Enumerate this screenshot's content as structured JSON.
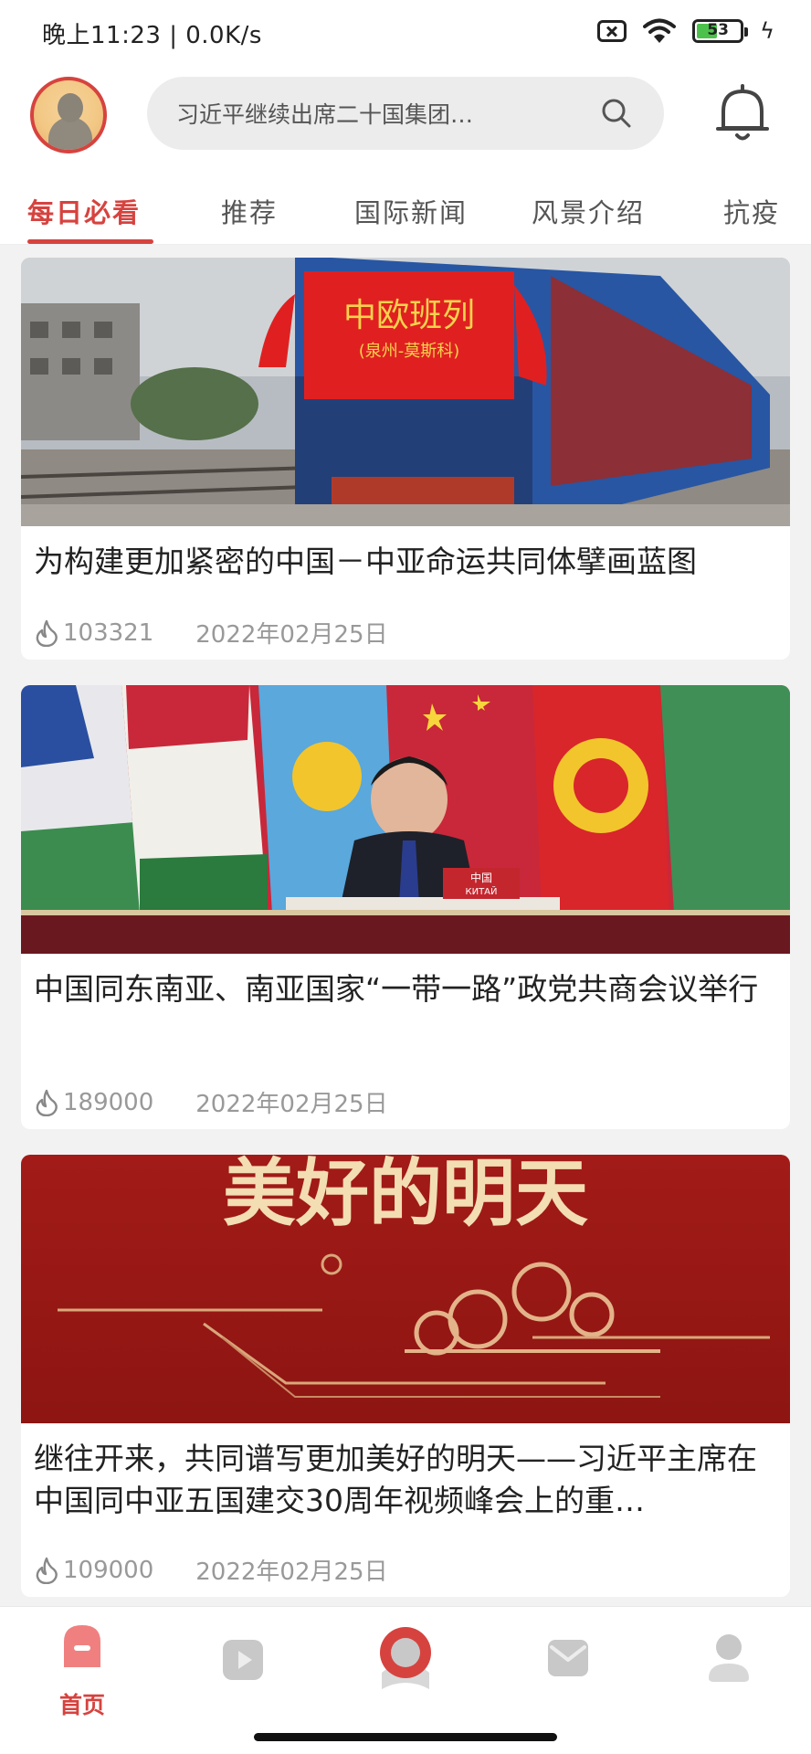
{
  "status_bar": {
    "time": "晚上11:23 | 0.0K/s",
    "battery": "53"
  },
  "header": {
    "search_placeholder": "习近平继续出席二十国集团…"
  },
  "tabs": [
    {
      "label": "每日必看",
      "active": true
    },
    {
      "label": "推荐",
      "active": false
    },
    {
      "label": "国际新闻",
      "active": false
    },
    {
      "label": "风景介绍",
      "active": false
    },
    {
      "label": "抗疫",
      "active": false
    }
  ],
  "articles": [
    {
      "title": "为构建更加紧密的中国－中亚命运共同体擘画蓝图",
      "views": "103321",
      "date": "2022年02月25日",
      "image": {
        "banner": "中欧班列",
        "sub": "(泉州-莫斯科)"
      }
    },
    {
      "title": "中国同东南亚、南亚国家“一带一路”政党共商会议举行",
      "views": "189000",
      "date": "2022年02月25日",
      "image": {
        "nameplate": "中国",
        "nameplate_sub": "КИТАЙ"
      }
    },
    {
      "title": "继往开来，共同谱写更加美好的明天——习近平主席在中国同中亚五国建交30周年视频峰会上的重…",
      "views": "109000",
      "date": "2022年02月25日",
      "image": {
        "headline": "美好的明天"
      }
    }
  ],
  "bottom_nav": {
    "home_label": "首页"
  },
  "colors": {
    "accent": "#d6433f",
    "muted": "#999999"
  }
}
